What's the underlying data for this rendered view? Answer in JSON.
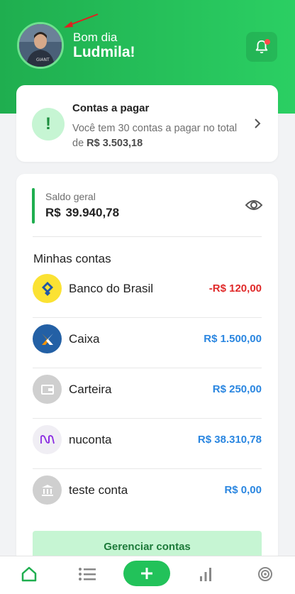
{
  "header": {
    "greeting": "Bom dia",
    "username": "Ludmila!",
    "gradient": [
      "#1fae4f",
      "#2bcf63"
    ],
    "notification_icon": "bell-icon",
    "notification_dot_color": "#ff4b4b"
  },
  "bills": {
    "title": "Contas a pagar",
    "description_prefix": "Você tem 30 contas a pagar no total de ",
    "total": "R$ 3.503,18",
    "icon": "exclamation-icon"
  },
  "balance": {
    "label": "Saldo geral",
    "value": "R$  39.940,78",
    "toggle_icon": "eye-icon"
  },
  "accounts": {
    "title": "Minhas contas",
    "items": [
      {
        "name": "Banco do Brasil",
        "amount": "-R$ 120,00",
        "icon": "banco-do-brasil-logo",
        "amount_color": "#e02a2a"
      },
      {
        "name": "Caixa",
        "amount": "R$ 1.500,00",
        "icon": "caixa-logo",
        "amount_color": "#2a86e0"
      },
      {
        "name": "Carteira",
        "amount": "R$ 250,00",
        "icon": "wallet-icon",
        "amount_color": "#2a86e0"
      },
      {
        "name": "nuconta",
        "amount": "R$ 38.310,78",
        "icon": "nubank-logo",
        "amount_color": "#2a86e0"
      },
      {
        "name": "teste conta",
        "amount": "R$ 0,00",
        "icon": "bank-icon",
        "amount_color": "#2a86e0"
      }
    ],
    "manage_label": "Gerenciar contas"
  },
  "tabbar": {
    "tabs": [
      "home-icon",
      "list-icon",
      "add-icon",
      "chart-icon",
      "target-icon"
    ],
    "active_color": "#1fae4f"
  }
}
